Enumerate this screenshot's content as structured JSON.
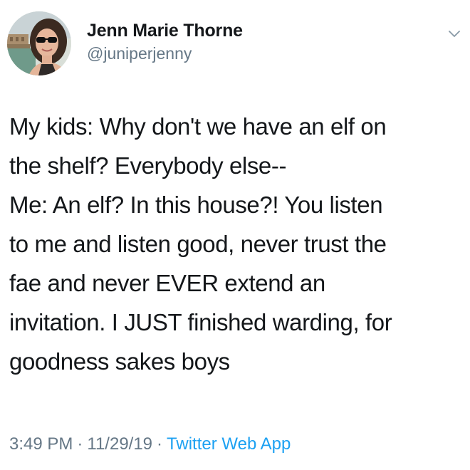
{
  "author": {
    "name": "Jenn Marie Thorne",
    "handle": "@juniperjenny"
  },
  "tweet": {
    "lines": [
      "My kids: Why don't we have an elf on",
      "the shelf? Everybody else--",
      "Me: An elf? In this house?! You listen",
      "to me and listen good, never trust the",
      "fae and never EVER extend an",
      "invitation. I JUST finished warding, for",
      "goodness sakes boys"
    ],
    "time": "3:49 PM",
    "separator": "·",
    "date": "11/29/19",
    "source": "Twitter Web App"
  },
  "icons": {
    "menu": "chevron-down-icon",
    "avatar": "profile-photo"
  },
  "colors": {
    "text": "#14171a",
    "secondary": "#657786",
    "link": "#1da1f2",
    "background": "#ffffff"
  }
}
